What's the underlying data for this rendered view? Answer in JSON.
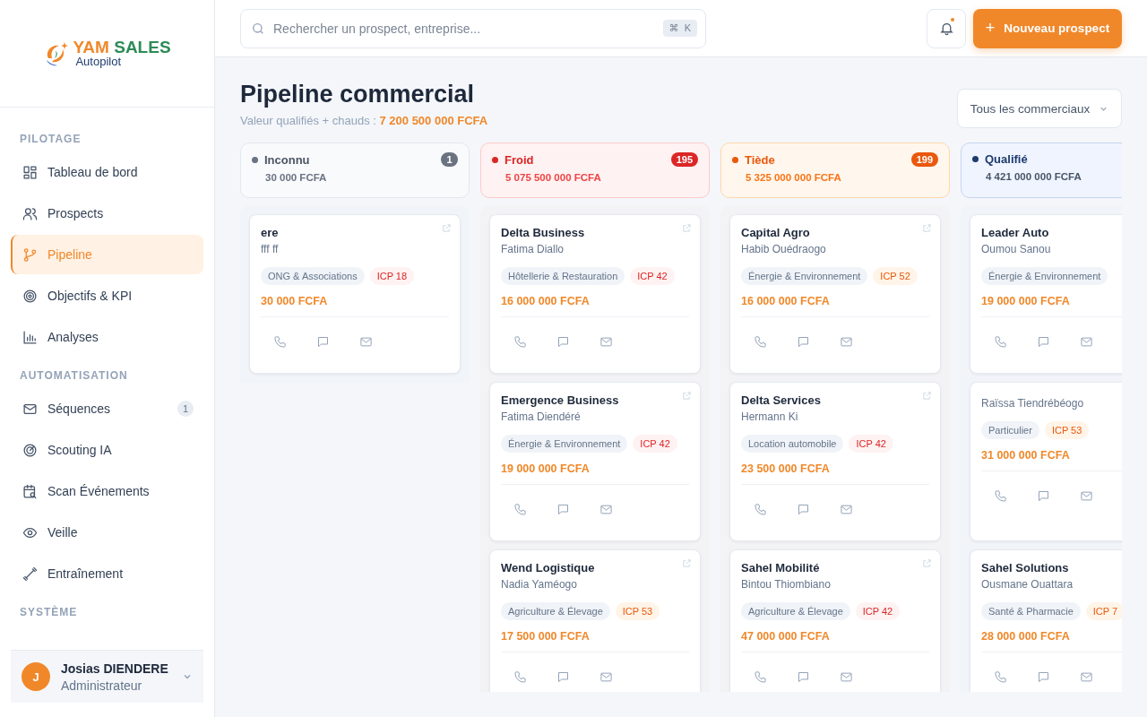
{
  "logo": {
    "brand_a": "YAM",
    "brand_b": "SALES",
    "tagline": "Autopilot"
  },
  "sidebar": {
    "sections": [
      {
        "title": "PILOTAGE",
        "items": [
          {
            "label": "Tableau de bord",
            "selected": false
          },
          {
            "label": "Prospects",
            "selected": false
          },
          {
            "label": "Pipeline",
            "selected": true
          },
          {
            "label": "Objectifs & KPI",
            "selected": false
          },
          {
            "label": "Analyses",
            "selected": false
          }
        ]
      },
      {
        "title": "AUTOMATISATION",
        "items": [
          {
            "label": "Séquences",
            "selected": false,
            "badge": "1"
          },
          {
            "label": "Scouting IA",
            "selected": false
          },
          {
            "label": "Scan Événements",
            "selected": false
          },
          {
            "label": "Veille",
            "selected": false
          },
          {
            "label": "Entraînement",
            "selected": false
          }
        ]
      },
      {
        "title": "SYSTÈME"
      }
    ],
    "user": {
      "initial": "J",
      "name": "Josias DIENDERE",
      "role": "Administrateur"
    }
  },
  "topbar": {
    "search": {
      "placeholder": "Rechercher un prospect, entreprise...",
      "shortcut_symbol": "⌘",
      "shortcut_key": "K"
    },
    "notification_dot": true,
    "primary_button": {
      "icon": "+",
      "label": "Nouveau prospect"
    }
  },
  "page": {
    "title": "Pipeline commercial",
    "subtitle": "Valeur qualifiés + chauds : ",
    "subtitle_value": "7 200 500 000 FCFA",
    "filter": "Tous les commerciaux"
  },
  "columns": [
    {
      "kind": "grey",
      "color": "#6b7280",
      "name": "Inconnu",
      "count": "1",
      "total": "30 000 FCFA",
      "cards": [
        {
          "title": "ere",
          "contact": "fff ff",
          "sector": "ONG & Associations",
          "icp": {
            "text": "ICP 18",
            "color": "#dc2626"
          },
          "amount": "30 000 FCFA"
        }
      ]
    },
    {
      "kind": "red",
      "color": "#dc2626",
      "name": "Froid",
      "count": "195",
      "total": "5 075 500 000 FCFA",
      "cards": [
        {
          "title": "Delta Business",
          "contact": "Fatima Diallo",
          "sector": "Hôtellerie & Restauration",
          "icp": {
            "text": "ICP 42",
            "color": "#dc2626"
          },
          "amount": "16 000 000 FCFA"
        },
        {
          "title": "Emergence Business",
          "contact": "Fatima Diendéré",
          "sector": "Énergie & Environnement",
          "icp": {
            "text": "ICP 42",
            "color": "#dc2626"
          },
          "amount": "19 000 000 FCFA"
        },
        {
          "title": "Wend Logistique",
          "contact": "Nadia Yaméogo",
          "sector": "Agriculture & Élevage",
          "icp": {
            "text": "ICP 53",
            "color": "#ea580c"
          },
          "amount": "17 500 000 FCFA"
        }
      ]
    },
    {
      "kind": "orange",
      "color": "#ea580c",
      "name": "Tiède",
      "count": "199",
      "total": "5 325 000 000 FCFA",
      "cards": [
        {
          "title": "Capital Agro",
          "contact": "Habib Ouédraogo",
          "sector": "Énergie & Environnement",
          "icp": {
            "text": "ICP 52",
            "color": "#ea580c"
          },
          "amount": "16 000 000 FCFA"
        },
        {
          "title": "Delta Services",
          "contact": "Hermann Ki",
          "sector": "Location automobile",
          "icp": {
            "text": "ICP 42",
            "color": "#dc2626"
          },
          "amount": "23 500 000 FCFA"
        },
        {
          "title": "Sahel Mobilité",
          "contact": "Bintou Thiombiano",
          "sector": "Agriculture & Élevage",
          "icp": {
            "text": "ICP 42",
            "color": "#dc2626"
          },
          "amount": "47 000 000 FCFA"
        }
      ]
    },
    {
      "kind": "blue",
      "color": "#1e3a6e",
      "name": "Qualifié",
      "total": "4 421 000 000 FCFA",
      "cards": [
        {
          "title": "Leader Auto",
          "contact": "Oumou Sanou",
          "sector": "Énergie & Environnement",
          "amount": "19 000 000 FCFA"
        },
        {
          "contact": "Raïssa Tiendrébéogo",
          "sector": "Particulier",
          "icp": {
            "text": "ICP 53",
            "color": "#ea580c"
          },
          "amount": "31 000 000 FCFA"
        },
        {
          "title": "Sahel Solutions",
          "contact": "Ousmane Ouattara",
          "sector": "Santé & Pharmacie",
          "icp": {
            "text": "ICP 7",
            "color": "#ea580c"
          },
          "amount": "28 000 000 FCFA"
        }
      ]
    }
  ]
}
